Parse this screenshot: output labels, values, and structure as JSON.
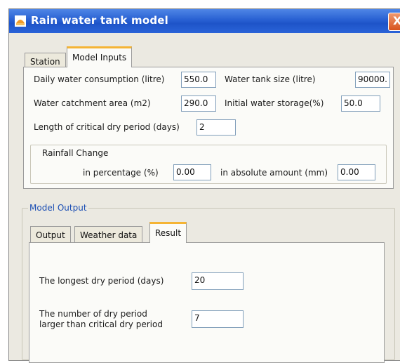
{
  "window": {
    "title": "Rain water tank model",
    "close_glyph": "X"
  },
  "top_tabs": [
    {
      "label": "Station",
      "selected": false
    },
    {
      "label": "Model Inputs",
      "selected": true
    }
  ],
  "inputs": {
    "daily_consumption": {
      "label": "Daily water consumption (litre)",
      "value": "550.0"
    },
    "tank_size": {
      "label": "Water tank size (litre)",
      "value": "90000."
    },
    "catchment_area": {
      "label": "Water catchment area (m2)",
      "value": "290.0"
    },
    "initial_storage": {
      "label": "Initial water storage(%)",
      "value": "50.0"
    },
    "critical_dry_period": {
      "label": "Length of critical dry period (days)",
      "value": "2"
    }
  },
  "rainfall_change": {
    "title": "Rainfall  Change",
    "percentage": {
      "label": "in percentage (%)",
      "value": "0.00"
    },
    "absolute": {
      "label": "in absolute amount (mm)",
      "value": "0.00"
    }
  },
  "model_output": {
    "legend": "Model Output",
    "tabs": [
      {
        "label": "Output",
        "selected": false
      },
      {
        "label": "Weather data",
        "selected": false
      },
      {
        "label": "Result",
        "selected": true
      }
    ],
    "longest_dry_period": {
      "label": "The longest dry period (days)",
      "value": "20"
    },
    "dry_period_count": {
      "label_line1": "The number of dry period",
      "label_line2": "larger than critical dry period",
      "value": "7"
    }
  },
  "colors": {
    "title_bar": "#2860d2",
    "window_bg": "#ebe9e1",
    "tab_accent": "#f5b434",
    "legend_text": "#1c4fb4"
  }
}
